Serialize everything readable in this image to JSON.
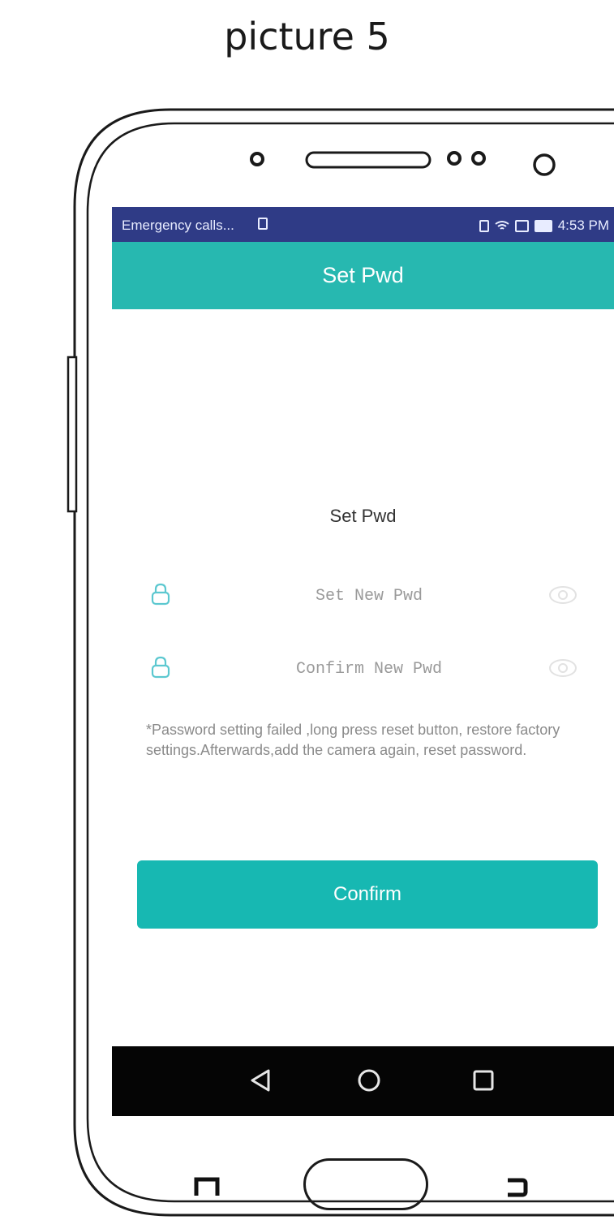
{
  "caption": "picture 5",
  "status_bar": {
    "carrier_text": "Emergency calls...",
    "time": "4:53 PM",
    "icons": [
      "sim-icon",
      "vibrate-icon",
      "wifi-icon",
      "signal-icon",
      "battery-icon"
    ]
  },
  "header": {
    "title": "Set Pwd"
  },
  "form": {
    "title": "Set Pwd",
    "new_password": {
      "placeholder": "Set New Pwd",
      "value": "",
      "icon": "lock-icon",
      "toggle_icon": "eye-icon"
    },
    "confirm_password": {
      "placeholder": "Confirm New Pwd",
      "value": "",
      "icon": "lock-icon",
      "toggle_icon": "eye-icon"
    },
    "hint": "*Password setting failed ,long press reset button, restore factory settings.Afterwards,add the camera again, reset password."
  },
  "confirm_button": {
    "label": "Confirm"
  },
  "nav_bar": {
    "icons": [
      "back-icon",
      "home-icon",
      "recent-apps-icon"
    ]
  },
  "colors": {
    "status_bar": "#2f3b86",
    "header": "#27b8b0",
    "button": "#17b8b2",
    "icon_accent": "#5cc8d0",
    "nav_bar": "#050505"
  }
}
